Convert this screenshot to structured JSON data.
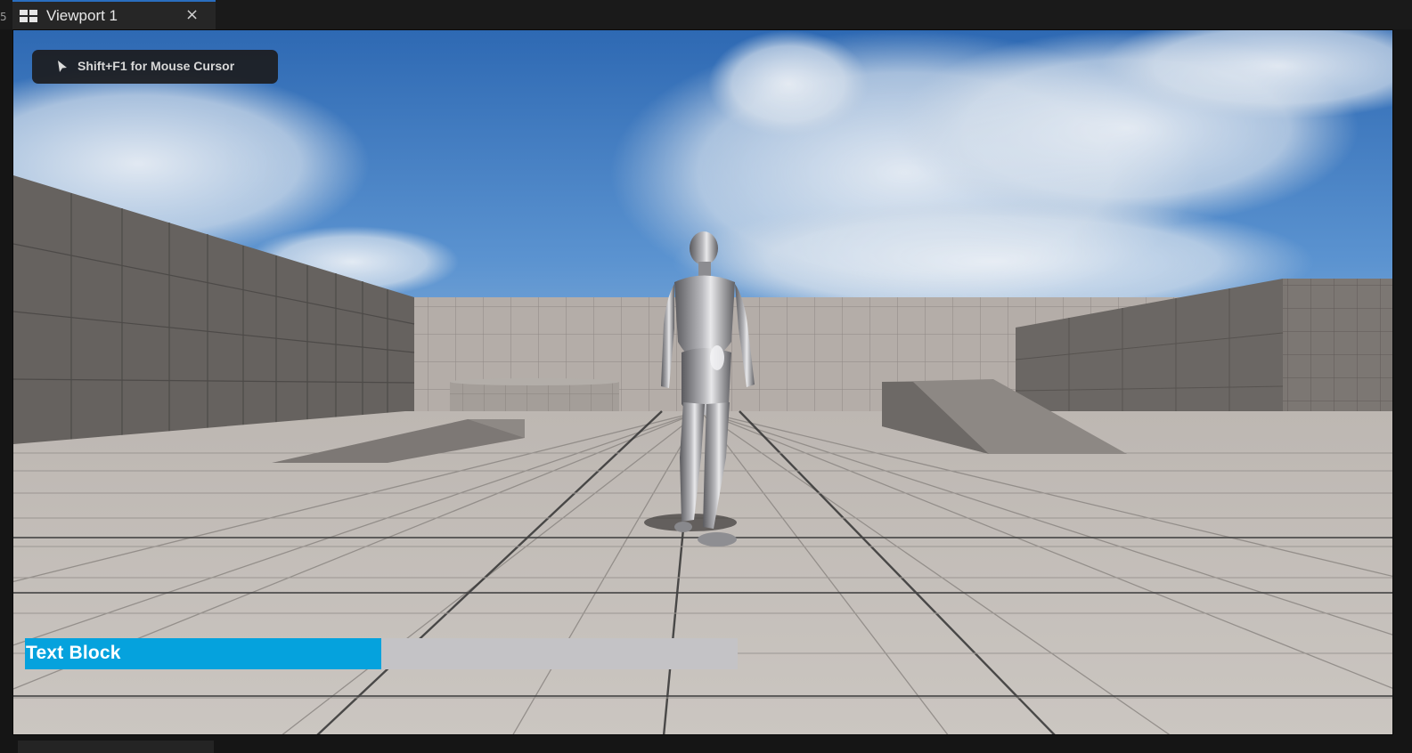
{
  "editor": {
    "edge_label": "5",
    "tab": {
      "title": "Viewport 1",
      "icon": "viewport-layout-icon",
      "close_icon": "×"
    }
  },
  "viewport": {
    "hint": {
      "icon": "cursor-arrow-icon",
      "text": "Shift+F1 for Mouse Cursor"
    },
    "hud": {
      "progress_bar": {
        "label": "Text Block",
        "percent": 50,
        "fill_color": "#05a2dd",
        "track_color": "#c4c3c6"
      }
    },
    "scene": {
      "sky_color": "#3f7cc4",
      "wall_color": "#b2aba6",
      "floor_color": "#c4bfba",
      "character": "silver-mannequin"
    }
  }
}
